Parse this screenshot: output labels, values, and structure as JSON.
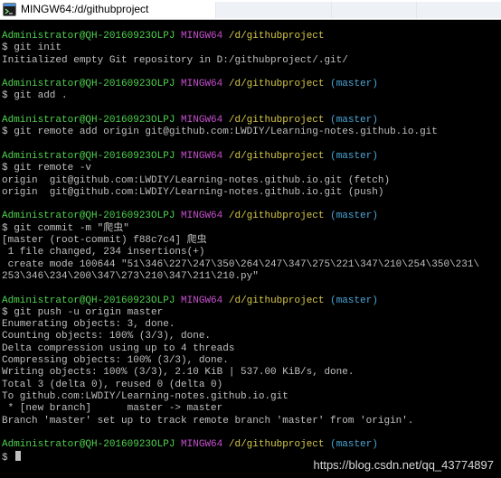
{
  "window": {
    "title": "MINGW64:/d/githubproject",
    "background_tabs": [
      "",
      "",
      ""
    ]
  },
  "prompt": {
    "user": "Administrator@QH-20160923OLPJ",
    "shell": "MINGW64",
    "path": "/d/githubproject",
    "branch": "(master)"
  },
  "terminal": {
    "blocks": [
      {
        "show_branch": false,
        "command": "$ git init",
        "output": [
          "Initialized empty Git repository in D:/githubproject/.git/"
        ]
      },
      {
        "show_branch": true,
        "command": "$ git add .",
        "output": []
      },
      {
        "show_branch": true,
        "command": "$ git remote add origin git@github.com:LWDIY/Learning-notes.github.io.git",
        "output": []
      },
      {
        "show_branch": true,
        "command": "$ git remote -v",
        "output": [
          "origin  git@github.com:LWDIY/Learning-notes.github.io.git (fetch)",
          "origin  git@github.com:LWDIY/Learning-notes.github.io.git (push)"
        ]
      },
      {
        "show_branch": true,
        "command": "$ git commit -m \"爬虫\"",
        "output": [
          "[master (root-commit) f88c7c4] 爬虫",
          " 1 file changed, 234 insertions(+)",
          " create mode 100644 \"51\\346\\227\\247\\350\\264\\247\\347\\275\\221\\347\\210\\254\\350\\231\\",
          "253\\346\\234\\200\\347\\273\\210\\347\\211\\210.py\""
        ]
      },
      {
        "show_branch": true,
        "command": "$ git push -u origin master",
        "output": [
          "Enumerating objects: 3, done.",
          "Counting objects: 100% (3/3), done.",
          "Delta compression using up to 4 threads",
          "Compressing objects: 100% (3/3), done.",
          "Writing objects: 100% (3/3), 2.10 KiB | 537.00 KiB/s, done.",
          "Total 3 (delta 0), reused 0 (delta 0)",
          "To github.com:LWDIY/Learning-notes.github.io.git",
          " * [new branch]      master -> master",
          "Branch 'master' set up to track remote branch 'master' from 'origin'."
        ]
      },
      {
        "show_branch": true,
        "command": "$ ",
        "output": []
      }
    ]
  },
  "watermark": "https://blog.csdn.net/qq_43774897",
  "colors": {
    "background": "#000000",
    "text": "#c0c0c0",
    "user": "#4fd24f",
    "shell": "#c84fd0",
    "path": "#d7c84a",
    "branch": "#4aa7d8"
  },
  "icons": {
    "window": "mingw-terminal-icon"
  }
}
